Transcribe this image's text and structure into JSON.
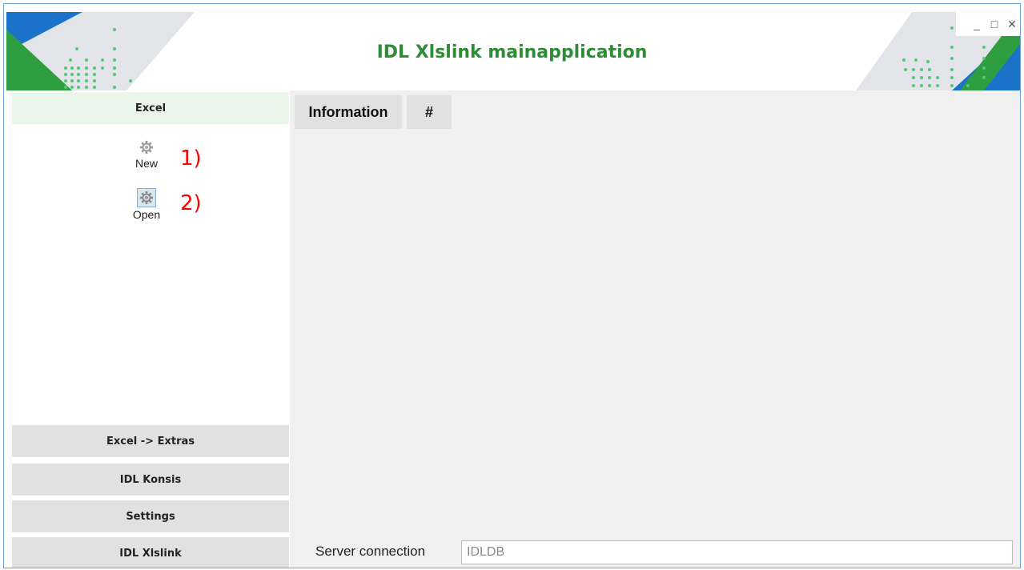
{
  "window": {
    "title": "IDL Xlslink mainapplication",
    "controls": {
      "minimize": "_",
      "maximize": "□",
      "close": "✕"
    }
  },
  "sidebar": {
    "active_section": "Excel",
    "tools": [
      {
        "label": "New",
        "icon": "gear-icon",
        "annotation": "1)"
      },
      {
        "label": "Open",
        "icon": "gear-icon",
        "annotation": "2)"
      }
    ],
    "sections": [
      {
        "label": "Excel -> Extras"
      },
      {
        "label": "IDL Konsis"
      },
      {
        "label": "Settings"
      },
      {
        "label": "IDL Xlslink"
      }
    ]
  },
  "main": {
    "tabs": [
      {
        "label": "Information"
      },
      {
        "label": "#"
      }
    ]
  },
  "status": {
    "server_label": "Server connection",
    "server_value": "IDLDB"
  },
  "colors": {
    "title_green": "#2e8b36",
    "accent_blue": "#1a73c8",
    "annotation_red": "#ff0000"
  }
}
